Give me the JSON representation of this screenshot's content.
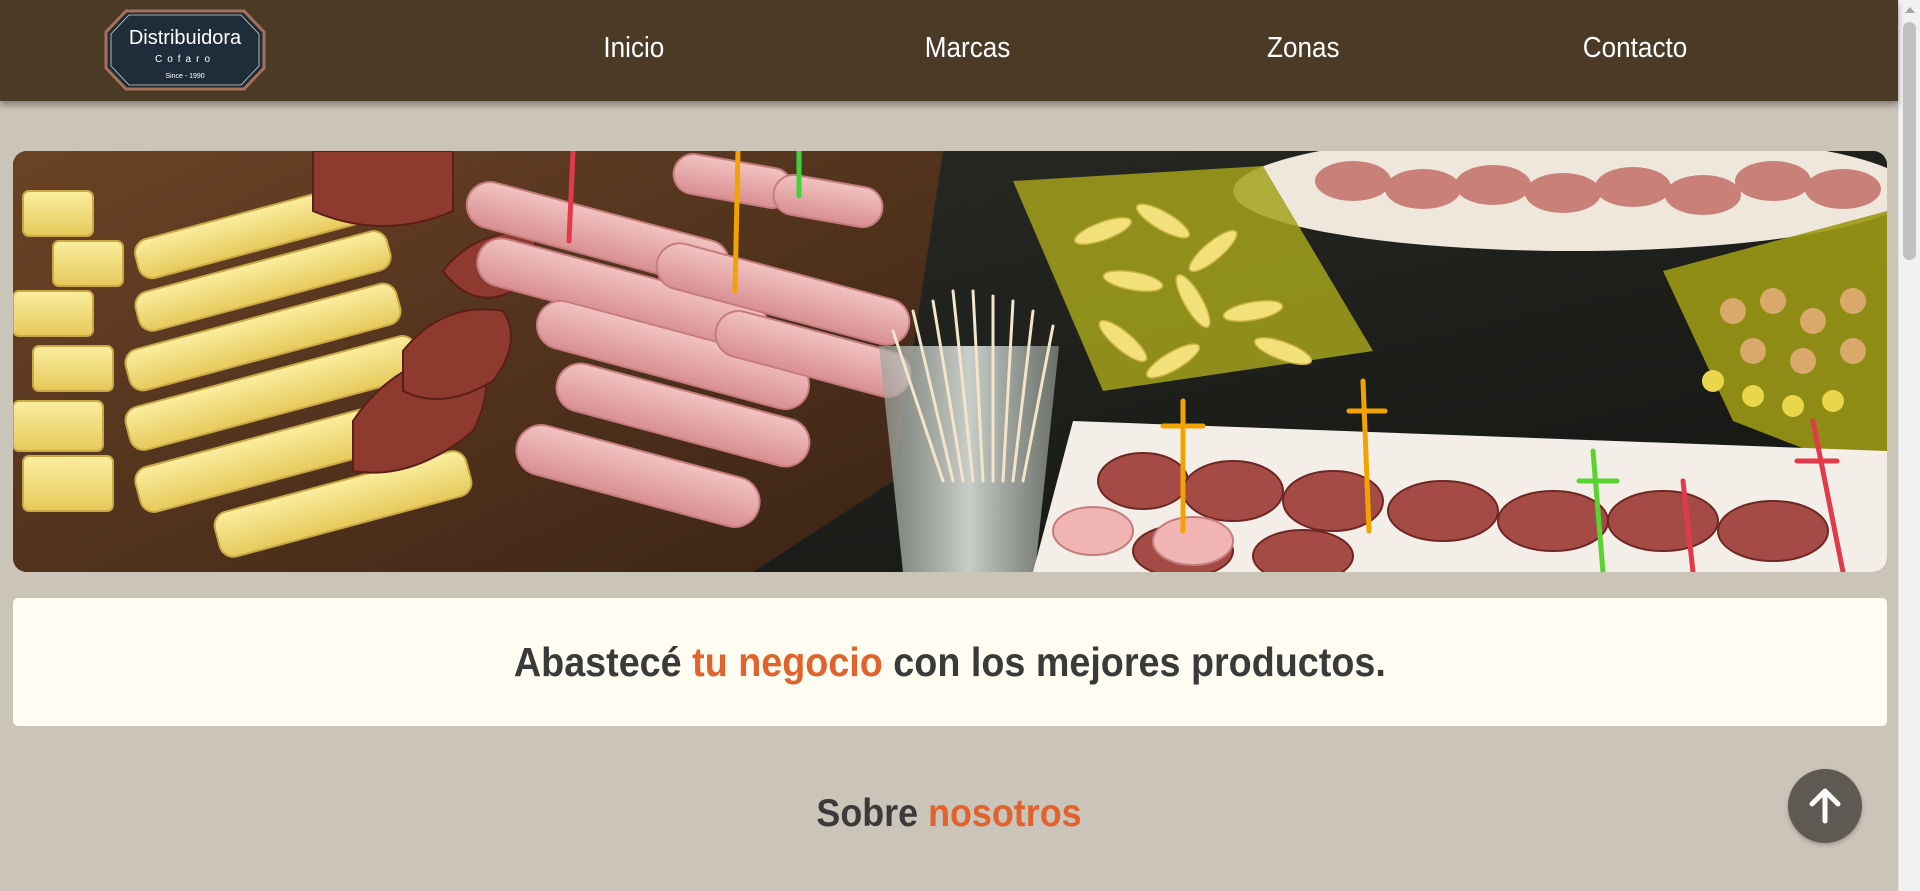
{
  "brand": {
    "logo_title": "Distribuidora",
    "logo_subtitle": "Cofaro",
    "logo_since": "Since - 1990",
    "logo_colors": {
      "fill": "#1f2d3a",
      "border": "#a5715b",
      "text": "#ffffff"
    }
  },
  "nav": {
    "items": [
      {
        "label": "Inicio"
      },
      {
        "label": "Marcas"
      },
      {
        "label": "Zonas"
      },
      {
        "label": "Contacto"
      }
    ]
  },
  "hero": {
    "alt": "Picada de fiambres, quesos, salamines, snacks y escarbadientes"
  },
  "tagline": {
    "part1": "Abastecé ",
    "highlight": "tu negocio",
    "part2": " con los mejores productos."
  },
  "about": {
    "title_part1": "Sobre ",
    "title_highlight": "nosotros"
  },
  "back_to_top": {
    "icon": "arrow-up-icon"
  },
  "colors": {
    "header_bg": "#4a3a26",
    "page_bg": "#cbc4b8",
    "card_bg": "#fffdf2",
    "accent": "#e0622c",
    "text_dark": "#3a3a3a",
    "button_bg": "#5e5a53"
  }
}
